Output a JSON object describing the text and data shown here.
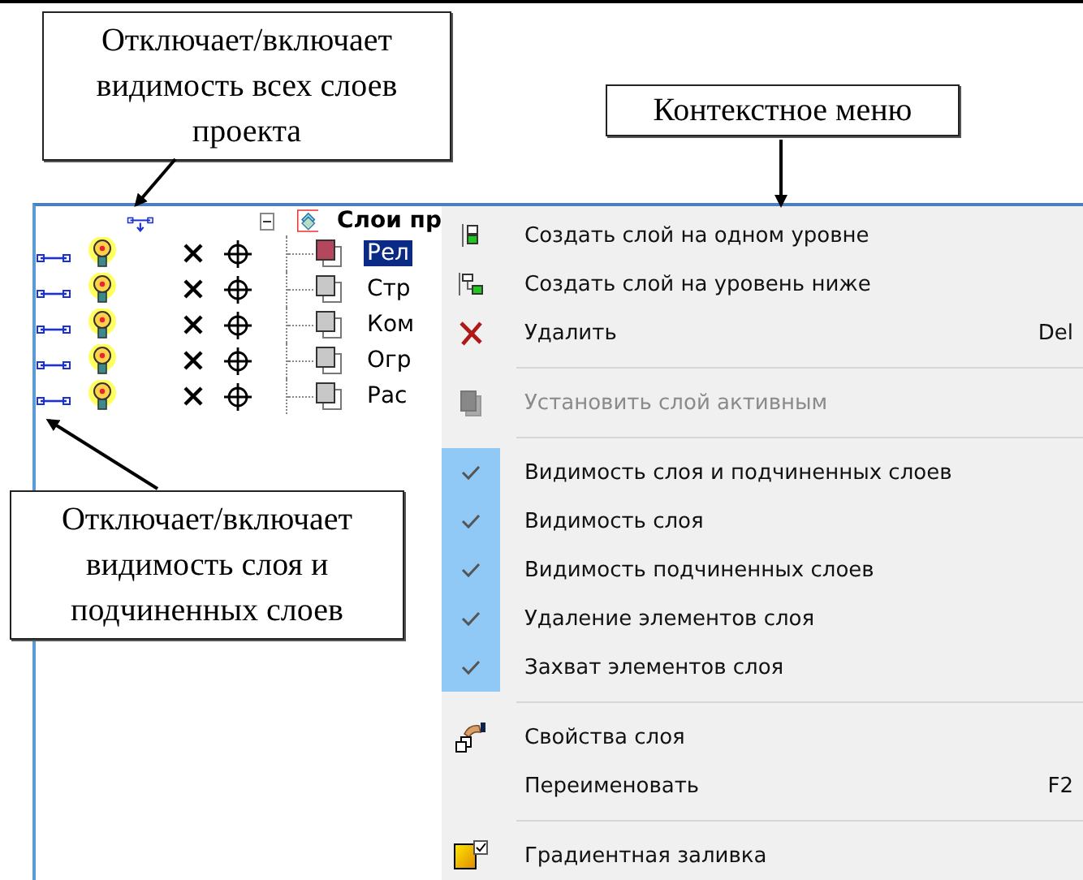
{
  "callouts": [
    {
      "text": "Отключает/включает видимость всех слоев проекта"
    },
    {
      "text": "Контекстное меню"
    },
    {
      "text": "Отключает/включает видимость слоя и подчиненных слоев"
    }
  ],
  "tree": {
    "label": "Слои пр",
    "expanded": true,
    "children": [
      {
        "label": "Рел",
        "selected": true,
        "active": true,
        "visible": true
      },
      {
        "label": "Стр",
        "selected": false,
        "active": false,
        "visible": true
      },
      {
        "label": "Ком",
        "selected": false,
        "active": false,
        "visible": true
      },
      {
        "label": "Огр",
        "selected": false,
        "active": false,
        "visible": true
      },
      {
        "label": "Рас",
        "selected": false,
        "active": false,
        "visible": true
      }
    ]
  },
  "menu": [
    {
      "kind": "command",
      "label": "Создать слой на одном уровне",
      "disabled": false
    },
    {
      "kind": "command",
      "label": "Создать слой на уровень ниже",
      "disabled": false
    },
    {
      "kind": "command",
      "label": "Удалить",
      "shortcut": "Del",
      "disabled": false
    },
    {
      "kind": "separator"
    },
    {
      "kind": "command",
      "label": "Установить слой активным",
      "disabled": true
    },
    {
      "kind": "separator"
    },
    {
      "kind": "check",
      "label": "Видимость слоя и подчиненных слоев",
      "checked": true
    },
    {
      "kind": "check",
      "label": "Видимость слоя",
      "checked": true
    },
    {
      "kind": "check",
      "label": "Видимость подчиненных слоев",
      "checked": true
    },
    {
      "kind": "check",
      "label": "Удаление элементов слоя",
      "checked": true
    },
    {
      "kind": "check",
      "label": "Захват элементов слоя",
      "checked": true
    },
    {
      "kind": "separator"
    },
    {
      "kind": "command",
      "label": "Свойства слоя",
      "disabled": false
    },
    {
      "kind": "command",
      "label": "Переименовать",
      "shortcut": "F2",
      "disabled": false
    },
    {
      "kind": "separator"
    },
    {
      "kind": "command",
      "label": "Градиентная заливка",
      "disabled": false
    }
  ]
}
